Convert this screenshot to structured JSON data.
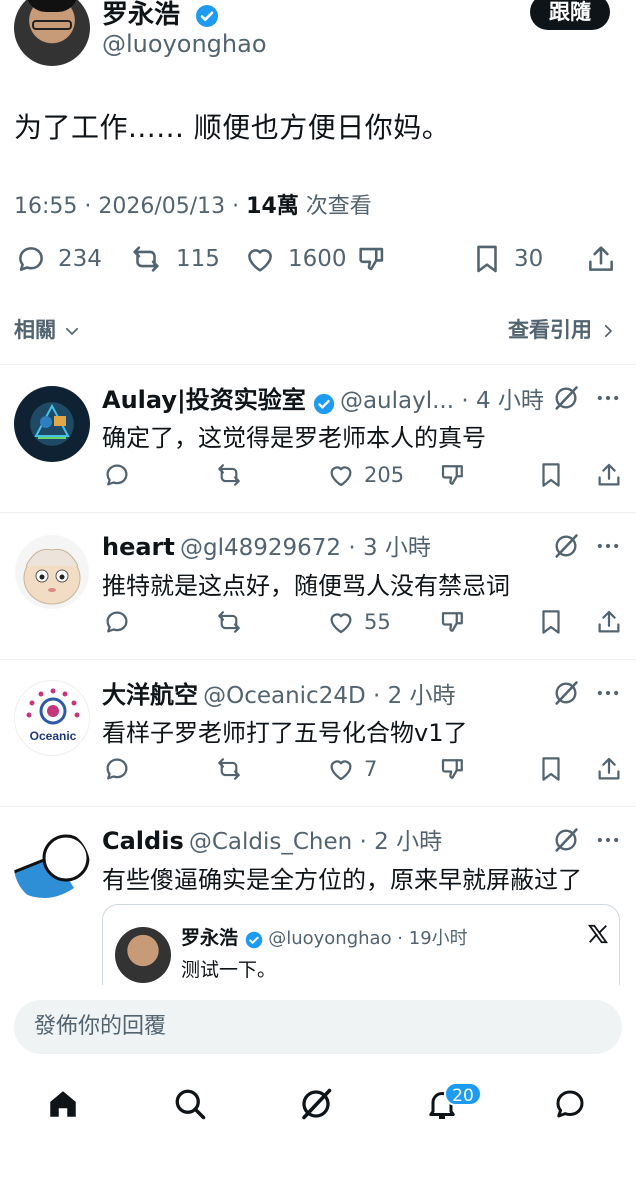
{
  "author": {
    "name": "罗永浩",
    "handle": "@luoyonghao",
    "follow_label": "跟隨"
  },
  "tweet": {
    "text": "为了工作...... 顺便也方便日你妈。",
    "time_date": "16:55 · 2026/05/13 · ",
    "views": "14萬",
    "views_label": " 次查看",
    "replies": "234",
    "retweets": "115",
    "likes": "1600",
    "bookmarks": "30"
  },
  "related_label": "相關",
  "quotes_label": "查看引用",
  "replies": [
    {
      "name": "Aulay|投资实验室",
      "sub": "@aulayl... · 4 小時",
      "text": "确定了，这觉得是罗老师本人的真号",
      "likes": "205"
    },
    {
      "name": "heart",
      "sub": "@gl48929672 · 3 小時",
      "text": "推特就是这点好，随便骂人没有禁忌词",
      "likes": "55"
    },
    {
      "name": "大洋航空",
      "sub": "@Oceanic24D · 2 小時",
      "text": "看样子罗老师打了五号化合物v1了",
      "likes": "7",
      "avatar_text": "Oceanic"
    },
    {
      "name": "Caldis",
      "sub": "@Caldis_Chen · 2 小時",
      "text": "有些傻逼确实是全方位的，原来早就屏蔽过了"
    }
  ],
  "quote": {
    "name": "罗永浩",
    "sub": "@luoyonghao · 19小时",
    "text": "测试一下。"
  },
  "reply_placeholder": "發佈你的回覆",
  "notifications_badge": "20",
  "colors": {
    "accent": "#1d9bf0",
    "muted": "#536471",
    "text": "#0f1419"
  }
}
